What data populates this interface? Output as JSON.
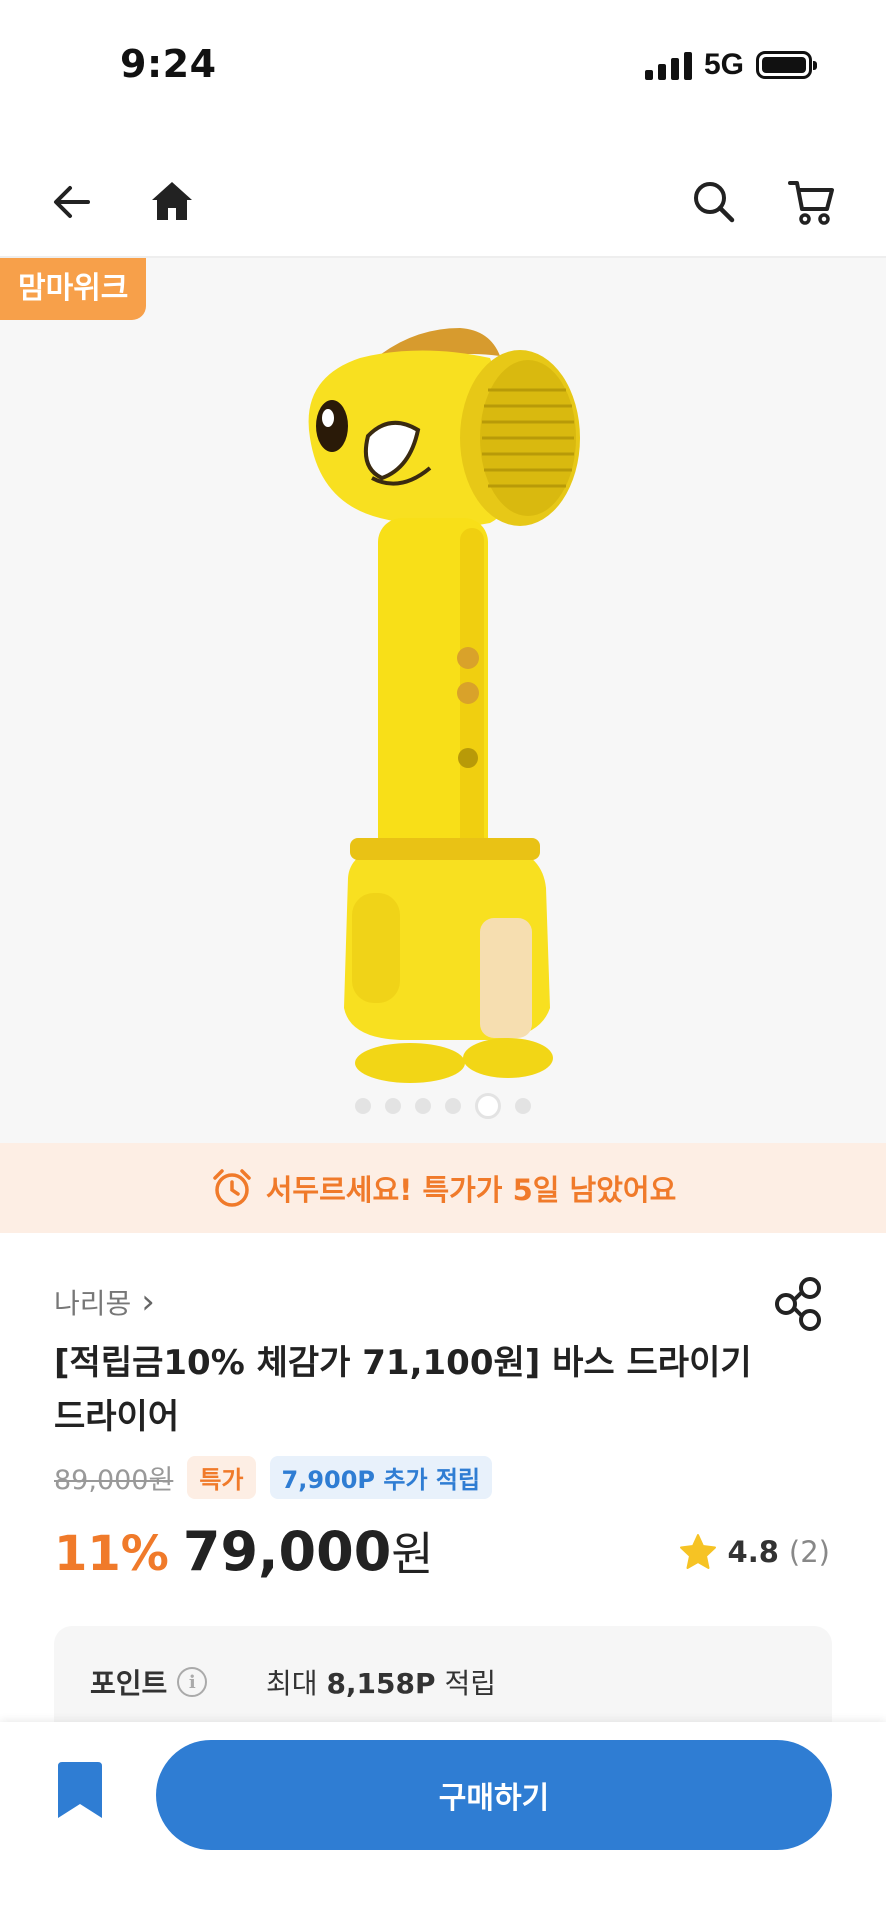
{
  "status_bar": {
    "time": "9:24",
    "network": "5G"
  },
  "nav": {
    "icons": [
      "back-arrow-icon",
      "home-icon",
      "search-icon",
      "cart-icon"
    ]
  },
  "hero": {
    "badge": "맘마위크",
    "image_count": 6,
    "active_index": 4
  },
  "hurry_banner": {
    "text": "서두르세요! 특가가 5일 남았어요",
    "color": "#f07a2a"
  },
  "product": {
    "brand": "나리몽",
    "brand_chevron": "›",
    "title": "[적립금10% 체감가 71,100원] 바스 드라이기 드라이어",
    "original_price": "89,000원",
    "tag_special": "특가",
    "tag_points": "7,900P 추가 적립",
    "discount": "11%",
    "price": "79,000",
    "currency": "원",
    "rating": "4.8",
    "review_count": "(2)"
  },
  "points": {
    "label": "포인트",
    "info_icon": "i",
    "prefix": "최대",
    "amount": "8,158P",
    "suffix": "적립"
  },
  "bottom_bar": {
    "buy_label": "구매하기"
  },
  "colors": {
    "accent_orange": "#f07a2a",
    "badge_orange": "#f7a04a",
    "primary_blue": "#2f7dd3",
    "star_yellow": "#f6c324"
  }
}
